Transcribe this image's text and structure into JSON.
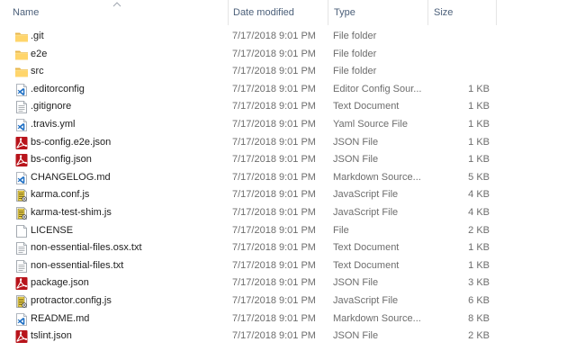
{
  "columns": {
    "name": "Name",
    "date": "Date modified",
    "type": "Type",
    "size": "Size"
  },
  "files": [
    {
      "name": ".git",
      "date": "7/17/2018 9:01 PM",
      "type": "File folder",
      "size": "",
      "icon": "folder-icon"
    },
    {
      "name": "e2e",
      "date": "7/17/2018 9:01 PM",
      "type": "File folder",
      "size": "",
      "icon": "folder-icon"
    },
    {
      "name": "src",
      "date": "7/17/2018 9:01 PM",
      "type": "File folder",
      "size": "",
      "icon": "folder-icon"
    },
    {
      "name": ".editorconfig",
      "date": "7/17/2018 9:01 PM",
      "type": "Editor Config Sour...",
      "size": "1 KB",
      "icon": "vscode-file-icon"
    },
    {
      "name": ".gitignore",
      "date": "7/17/2018 9:01 PM",
      "type": "Text Document",
      "size": "1 KB",
      "icon": "text-document-icon"
    },
    {
      "name": ".travis.yml",
      "date": "7/17/2018 9:01 PM",
      "type": "Yaml Source File",
      "size": "1 KB",
      "icon": "vscode-file-icon"
    },
    {
      "name": "bs-config.e2e.json",
      "date": "7/17/2018 9:01 PM",
      "type": "JSON File",
      "size": "1 KB",
      "icon": "acrobat-file-icon"
    },
    {
      "name": "bs-config.json",
      "date": "7/17/2018 9:01 PM",
      "type": "JSON File",
      "size": "1 KB",
      "icon": "acrobat-file-icon"
    },
    {
      "name": "CHANGELOG.md",
      "date": "7/17/2018 9:01 PM",
      "type": "Markdown Source...",
      "size": "5 KB",
      "icon": "vscode-file-icon"
    },
    {
      "name": "karma.conf.js",
      "date": "7/17/2018 9:01 PM",
      "type": "JavaScript File",
      "size": "4 KB",
      "icon": "script-file-icon"
    },
    {
      "name": "karma-test-shim.js",
      "date": "7/17/2018 9:01 PM",
      "type": "JavaScript File",
      "size": "4 KB",
      "icon": "script-file-icon"
    },
    {
      "name": "LICENSE",
      "date": "7/17/2018 9:01 PM",
      "type": "File",
      "size": "2 KB",
      "icon": "blank-file-icon"
    },
    {
      "name": "non-essential-files.osx.txt",
      "date": "7/17/2018 9:01 PM",
      "type": "Text Document",
      "size": "1 KB",
      "icon": "text-document-icon"
    },
    {
      "name": "non-essential-files.txt",
      "date": "7/17/2018 9:01 PM",
      "type": "Text Document",
      "size": "1 KB",
      "icon": "text-document-icon"
    },
    {
      "name": "package.json",
      "date": "7/17/2018 9:01 PM",
      "type": "JSON File",
      "size": "3 KB",
      "icon": "acrobat-file-icon"
    },
    {
      "name": "protractor.config.js",
      "date": "7/17/2018 9:01 PM",
      "type": "JavaScript File",
      "size": "6 KB",
      "icon": "script-file-icon"
    },
    {
      "name": "README.md",
      "date": "7/17/2018 9:01 PM",
      "type": "Markdown Source...",
      "size": "8 KB",
      "icon": "vscode-file-icon"
    },
    {
      "name": "tslint.json",
      "date": "7/17/2018 9:01 PM",
      "type": "JSON File",
      "size": "2 KB",
      "icon": "acrobat-file-icon"
    }
  ],
  "colors": {
    "header_text": "#4c607a",
    "detail_text": "#6d6d6d",
    "folder": "#ffd56b",
    "acrobat_red": "#b8141b",
    "vscode_blue": "#1e6fc4"
  }
}
